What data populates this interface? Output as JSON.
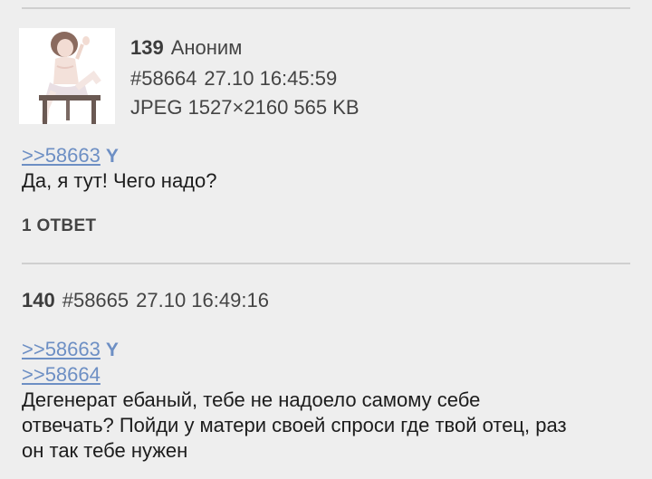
{
  "posts": [
    {
      "index": "139",
      "author": "Аноним",
      "post_id": "#58664",
      "datetime": "27.10 16:45:59",
      "file_info": "JPEG 1527×2160 565 KB",
      "refs": [
        {
          "label": ">>58663",
          "you": "Y"
        }
      ],
      "text": "Да, я тут! Чего надо?",
      "replies_label": "1 ОТВЕТ"
    },
    {
      "index": "140",
      "post_id": "#58665",
      "datetime": "27.10 16:49:16",
      "refs": [
        {
          "label": ">>58663",
          "you": "Y"
        },
        {
          "label": ">>58664"
        }
      ],
      "text_lines": [
        "Дегенерат ебаный, тебе не надоело самому себе",
        "отвечать? Пойди у матери своей спроси где твой отец, раз",
        "он так тебе нужен"
      ]
    }
  ],
  "colors": {
    "background": "#eeeeee",
    "link": "#6d8fc4",
    "divider": "#cfcfcf",
    "text": "#1c1c1c"
  }
}
